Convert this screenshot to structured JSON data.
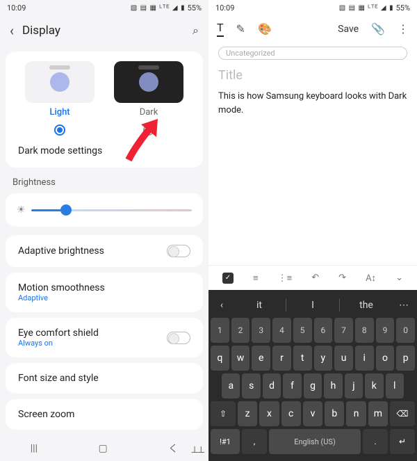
{
  "status": {
    "time": "10:09",
    "battery": "55%",
    "net_icons": "▧ ▤ ▦ ᴸᵀᴱ ◢ ▮"
  },
  "left": {
    "title": "Display",
    "theme": {
      "light_label": "Light",
      "dark_label": "Dark",
      "selected": "light"
    },
    "dark_mode_settings": "Dark mode settings",
    "brightness_label": "Brightness",
    "items": {
      "adaptive": "Adaptive brightness",
      "motion": {
        "title": "Motion smoothness",
        "sub": "Adaptive"
      },
      "eye": {
        "title": "Eye comfort shield",
        "sub": "Always on"
      },
      "font": "Font size and style",
      "zoom": "Screen zoom"
    }
  },
  "right": {
    "save": "Save",
    "category": "Uncategorized",
    "title_placeholder": "Title",
    "note_text": "This is how Samsung keyboard looks with Dark mode."
  },
  "keyboard": {
    "suggestions": [
      "it",
      "I",
      "the"
    ],
    "row_num": [
      "1",
      "2",
      "3",
      "4",
      "5",
      "6",
      "7",
      "8",
      "9",
      "0"
    ],
    "row_top": [
      "q",
      "w",
      "e",
      "r",
      "t",
      "y",
      "u",
      "i",
      "o",
      "p"
    ],
    "row_mid": [
      "a",
      "s",
      "d",
      "f",
      "g",
      "h",
      "j",
      "k",
      "l"
    ],
    "row_bot": [
      "z",
      "x",
      "c",
      "v",
      "b",
      "n",
      "m"
    ],
    "shift": "⇧",
    "backspace": "⌫",
    "sym": "!#1",
    "comma": ",",
    "space_label": "English (US)",
    "period": ".",
    "enter": "↵"
  }
}
